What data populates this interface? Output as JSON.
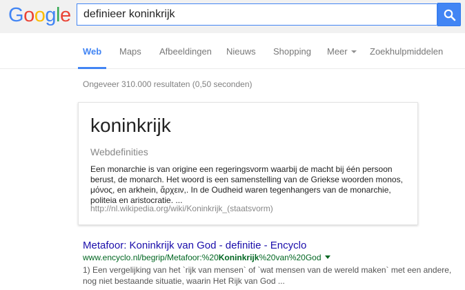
{
  "logo": {
    "letters": [
      "G",
      "o",
      "o",
      "g",
      "l",
      "e"
    ],
    "colors": [
      "#4285f4",
      "#ea4335",
      "#fbbc05",
      "#4285f4",
      "#34a853",
      "#ea4335"
    ]
  },
  "search": {
    "query": "definieer koninkrijk",
    "button_icon": "search-icon",
    "accent": "#4285f4"
  },
  "tabs": [
    {
      "label": "Web",
      "active": true
    },
    {
      "label": "Maps"
    },
    {
      "label": "Afbeeldingen"
    },
    {
      "label": "Nieuws"
    },
    {
      "label": "Shopping"
    },
    {
      "label": "Meer",
      "has_caret": true
    },
    {
      "label": "Zoekhulpmiddelen"
    }
  ],
  "stats": "Ongeveer 310.000 resultaten (0,50 seconden)",
  "definition_card": {
    "term": "koninkrijk",
    "source_label": "Webdefinities",
    "text": "Een monarchie is van origine een regeringsvorm waarbij de macht bij één persoon berust, de monarch. Het woord is een samenstelling van de Griekse woorden monos, μόνος, en arkhein, ἄρχειν,. In de Oudheid waren tegenhangers van de monarchie, politeia en aristocratie. ...",
    "url": "http://nl.wikipedia.org/wiki/Koninkrijk_(staatsvorm)"
  },
  "result": {
    "title": "Metafoor: Koninkrijk van God - definitie - Encyclo",
    "url_prefix": "www.encyclo.nl/begrip/Metafoor:%20",
    "url_bold": "Koninkrijk",
    "url_suffix": "%20van%20God",
    "snippet": "1) Een vergelijking van het `rijk van mensen` of `wat mensen van de wereld maken` met een andere, nog niet bestaande situatie, waarin Het Rijk van God ..."
  }
}
